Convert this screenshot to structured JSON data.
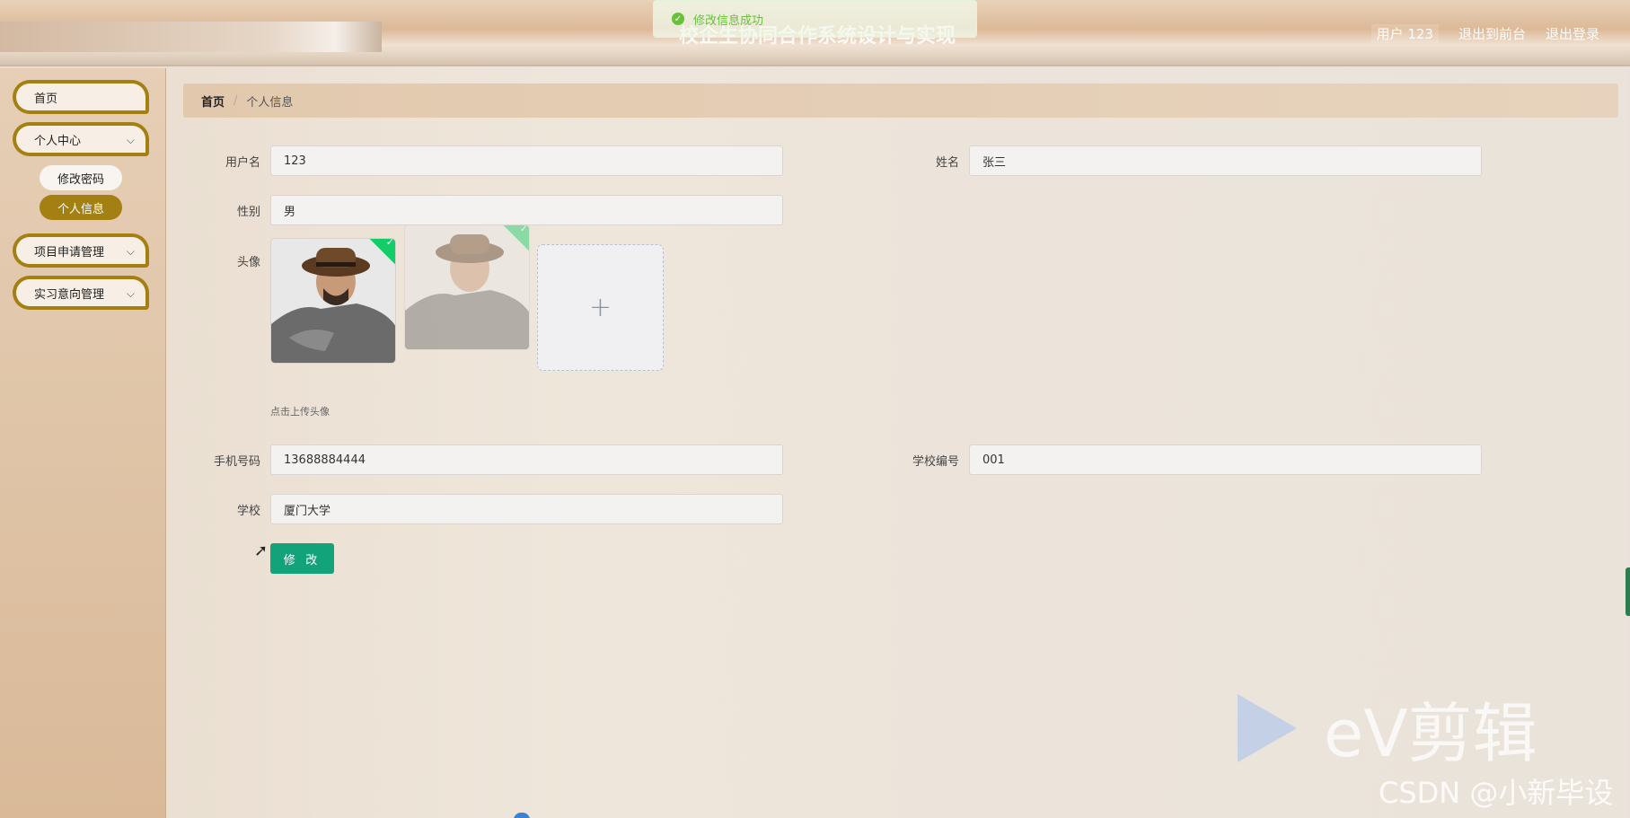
{
  "header": {
    "title": "校企生协同合作系统设计与实现",
    "user": "用户 123",
    "to_front": "退出到前台",
    "logout": "退出登录"
  },
  "toast": {
    "message": "修改信息成功",
    "icon": "check-circle-icon"
  },
  "sidebar": {
    "items": [
      {
        "label": "首页"
      },
      {
        "label": "个人中心",
        "submenu": [
          {
            "label": "修改密码"
          },
          {
            "label": "个人信息",
            "active": true
          }
        ]
      },
      {
        "label": "项目申请管理"
      },
      {
        "label": "实习意向管理"
      }
    ]
  },
  "breadcrumb": {
    "home": "首页",
    "separator": "/",
    "current": "个人信息"
  },
  "form": {
    "username": {
      "label": "用户名",
      "value": "123"
    },
    "name": {
      "label": "姓名",
      "value": "张三"
    },
    "gender": {
      "label": "性别",
      "value": "男"
    },
    "avatar": {
      "label": "头像",
      "hint": "点击上传头像",
      "upload_icon": "+"
    },
    "phone": {
      "label": "手机号码",
      "value": "13688884444"
    },
    "school_no": {
      "label": "学校编号",
      "value": "001"
    },
    "school": {
      "label": "学校",
      "value": "厦门大学"
    },
    "submit_label": "修 改"
  },
  "watermark": {
    "ev": "eV剪辑",
    "csdn": "CSDN @小新毕设"
  },
  "colors": {
    "accent": "#a47f12",
    "submit": "#13a37a",
    "success": "#67c23a"
  }
}
